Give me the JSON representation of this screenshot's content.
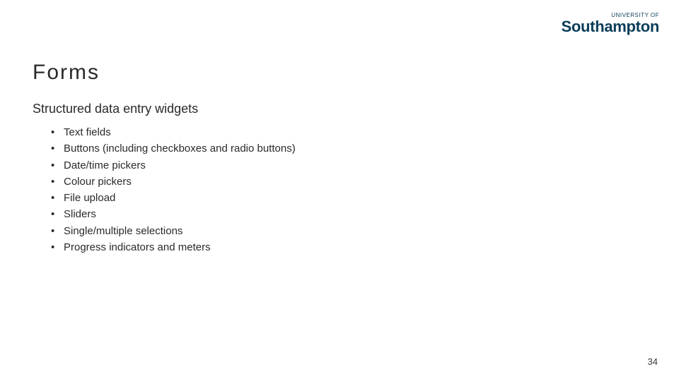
{
  "logo": {
    "top_line": "UNIVERSITY OF",
    "main": "Southampton"
  },
  "title": "Forms",
  "subtitle": "Structured data entry widgets",
  "bullets": [
    "Text fields",
    "Buttons (including checkboxes and radio buttons)",
    "Date/time pickers",
    "Colour pickers",
    "File upload",
    "Sliders",
    "Single/multiple selections",
    "Progress indicators and meters"
  ],
  "page_number": "34"
}
